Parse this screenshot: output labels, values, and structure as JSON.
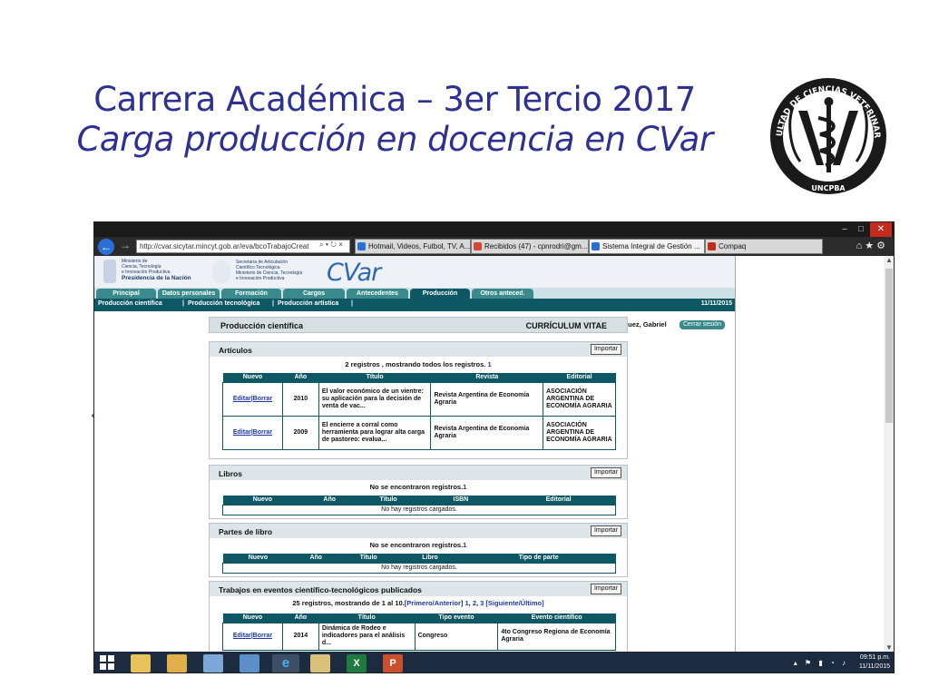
{
  "slide": {
    "title_line1": "Carrera Académica – 3er Tercio 2017",
    "title_line2": "Carga producción en docencia en CVar"
  },
  "logo": {
    "ring_text_top": "FACULTAD DE CIENCIAS VETERINARIAS",
    "ring_text_bottom": "UNCPBA",
    "ink_color": "#1a1a1a"
  },
  "arrow": {
    "color": "#4f81bd",
    "icon": "arrow-up-right"
  },
  "browser": {
    "address": "http://cvar.sicytar.mincyt.gob.ar/eva/bcoTrabajoCreat",
    "tabs": [
      {
        "label": "Hotmail, Videos, Futbol, TV, A...",
        "color": "#2a6fd6"
      },
      {
        "label": "Recibidos (47) - cpnrodri@gm...",
        "color": "#d14836"
      },
      {
        "label": "Sistema Integral de Gestión ...",
        "color": "#2a6fd6"
      },
      {
        "label": "Compaq",
        "color": "#c42b1c"
      }
    ]
  },
  "site": {
    "header_left": [
      "Ministerio de",
      "Ciencia, Tecnología",
      "e Innovación Productiva",
      "Presidencia de la Nación"
    ],
    "header_mid": [
      "Secretaría de Articulación",
      "Científico Tecnológica",
      "Ministerio de Ciencia, Tecnología",
      "e Innovación Productiva"
    ],
    "logo": "CVar",
    "menu": [
      "Principal",
      "Datos personales",
      "Formación",
      "Cargos",
      "Antecedentes",
      "Producción",
      "Otros anteced."
    ],
    "active_menu": "Producción",
    "user": "Rodríguez, Gabriel",
    "logout": "Cerrar sesión",
    "submenu": [
      "Producción científica",
      "Producción tecnológica",
      "Producción artística"
    ],
    "date": "11/11/2015"
  },
  "panel": {
    "title": "Producción científica",
    "right": "CURRÍCULUM VITAE"
  },
  "import_label": "Importar",
  "sections": {
    "articulos": {
      "title": "Artículos",
      "summary": "2 registros , mostrando todos los registros.",
      "page_link": "1",
      "headers": [
        "Nuevo",
        "Año",
        "Título",
        "Revista",
        "Editorial"
      ],
      "rows": [
        {
          "edit": "Editar",
          "del": "Borrar",
          "year": "2010",
          "title": "El valor económico de un vientre: su aplicación para la decisión de venta de vac...",
          "journal": "Revista Argentina de Economía Agraria",
          "publisher": "ASOCIACIÓN ARGENTINA DE ECONOMÍA AGRARIA"
        },
        {
          "edit": "Editar",
          "del": "Borrar",
          "year": "2009",
          "title": "El encierre a corral como herramienta para lograr alta carga de pastoreo: evalua...",
          "journal": "Revista Argentina de Economía Agraria",
          "publisher": "ASOCIACIÓN ARGENTINA DE ECONOMÍA AGRARIA"
        }
      ]
    },
    "libros": {
      "title": "Libros",
      "summary": "No se encontraron registros.",
      "page_link": "1",
      "headers": [
        "Nuevo",
        "Año",
        "Título",
        "ISBN",
        "Editorial"
      ],
      "empty": "No hay registros cargados."
    },
    "partes": {
      "title": "Partes de libro",
      "summary": "No se encontraron registros.",
      "page_link": "1",
      "headers": [
        "Nuevo",
        "Año",
        "Título",
        "Libro",
        "Tipo de parte"
      ],
      "empty": "No hay registros cargados."
    },
    "trabajos": {
      "title": "Trabajos en eventos científico-tecnológicos publicados",
      "summary": "25 registros, mostrando de 1 al 10.",
      "nav": {
        "first": "Primero",
        "prev": "Anterior",
        "p1": "1",
        "p2": "2",
        "p3": "3",
        "next": "Siguiente",
        "last": "Último"
      },
      "headers": [
        "Nuevo",
        "Año",
        "Título",
        "Tipo evento",
        "Evento científico"
      ],
      "rows": [
        {
          "edit": "Editar",
          "del": "Borrar",
          "year": "2014",
          "title": "Dinámica de Rodeo e indicadores para el análisis d...",
          "type": "Congreso",
          "event": "4to Congreso Regiona de Economía Agraria"
        }
      ]
    }
  },
  "taskbar": {
    "time": "09:51 p.m.",
    "date": "11/11/2015",
    "apps": [
      "file-explorer-icon",
      "folder-icon",
      "notes-icon",
      "remote-desktop-icon",
      "network-icon",
      "ie-icon",
      "archive-icon",
      "excel-icon",
      "powerpoint-icon"
    ]
  }
}
